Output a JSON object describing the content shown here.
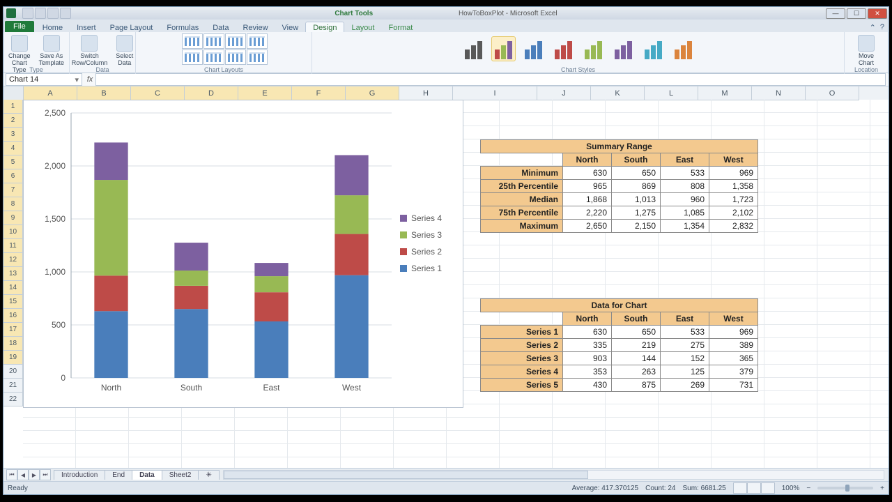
{
  "window": {
    "title_context": "Chart Tools",
    "title_doc": "HowToBoxPlot - Microsoft Excel"
  },
  "tabs": {
    "file": "File",
    "items": [
      "Home",
      "Insert",
      "Page Layout",
      "Formulas",
      "Data",
      "Review",
      "View"
    ],
    "context": [
      "Design",
      "Layout",
      "Format"
    ],
    "active": "Design"
  },
  "ribbon": {
    "type_group": "Type",
    "change_chart_type": "Change\nChart Type",
    "save_as_template": "Save As\nTemplate",
    "data_group": "Data",
    "switch_rowcol": "Switch\nRow/Column",
    "select_data": "Select\nData",
    "layouts_group": "Chart Layouts",
    "styles_group": "Chart Styles",
    "location_group": "Location",
    "move_chart": "Move\nChart"
  },
  "namebox": "Chart 14",
  "columns": [
    "A",
    "B",
    "C",
    "D",
    "E",
    "F",
    "G",
    "H",
    "I",
    "J",
    "K",
    "L",
    "M",
    "N",
    "O"
  ],
  "rows": 22,
  "chart_data": {
    "type": "bar",
    "stacked": true,
    "categories": [
      "North",
      "South",
      "East",
      "West"
    ],
    "series": [
      {
        "name": "Series 1",
        "color": "#4a7ebb",
        "values": [
          630,
          650,
          533,
          969
        ]
      },
      {
        "name": "Series 2",
        "color": "#be4b48",
        "values": [
          335,
          219,
          275,
          389
        ]
      },
      {
        "name": "Series 3",
        "color": "#98b954",
        "values": [
          903,
          144,
          152,
          365
        ]
      },
      {
        "name": "Series 4",
        "color": "#7d60a0",
        "values": [
          353,
          263,
          125,
          379
        ]
      }
    ],
    "ylim": [
      0,
      2500
    ],
    "yticks": [
      0,
      500,
      1000,
      1500,
      2000,
      2500
    ],
    "yticklabels": [
      "0",
      "500",
      "1,000",
      "1,500",
      "2,000",
      "2,500"
    ],
    "legend_order": [
      "Series 4",
      "Series 3",
      "Series 2",
      "Series 1"
    ]
  },
  "summary_table": {
    "title": "Summary Range",
    "cols": [
      "North",
      "South",
      "East",
      "West"
    ],
    "rows": [
      {
        "label": "Minimum",
        "vals": [
          "630",
          "650",
          "533",
          "969"
        ]
      },
      {
        "label": "25th Percentile",
        "vals": [
          "965",
          "869",
          "808",
          "1,358"
        ]
      },
      {
        "label": "Median",
        "vals": [
          "1,868",
          "1,013",
          "960",
          "1,723"
        ]
      },
      {
        "label": "75th Percentile",
        "vals": [
          "2,220",
          "1,275",
          "1,085",
          "2,102"
        ]
      },
      {
        "label": "Maximum",
        "vals": [
          "2,650",
          "2,150",
          "1,354",
          "2,832"
        ]
      }
    ]
  },
  "chart_table": {
    "title": "Data for Chart",
    "cols": [
      "North",
      "South",
      "East",
      "West"
    ],
    "rows": [
      {
        "label": "Series 1",
        "vals": [
          "630",
          "650",
          "533",
          "969"
        ]
      },
      {
        "label": "Series 2",
        "vals": [
          "335",
          "219",
          "275",
          "389"
        ]
      },
      {
        "label": "Series 3",
        "vals": [
          "903",
          "144",
          "152",
          "365"
        ]
      },
      {
        "label": "Series 4",
        "vals": [
          "353",
          "263",
          "125",
          "379"
        ]
      },
      {
        "label": "Series 5",
        "vals": [
          "430",
          "875",
          "269",
          "731"
        ]
      }
    ]
  },
  "sheet_tabs": {
    "items": [
      "Introduction",
      "End",
      "Data",
      "Sheet2"
    ],
    "active": "Data"
  },
  "status": {
    "ready": "Ready",
    "average": "Average: 417.370125",
    "count": "Count: 24",
    "sum": "Sum: 6681.25",
    "zoom": "100%"
  },
  "style_palettes": [
    [
      "#595959",
      "#595959",
      "#595959"
    ],
    [
      "#be4b48",
      "#98b954",
      "#7d60a0"
    ],
    [
      "#4a7ebb",
      "#4a7ebb",
      "#4a7ebb"
    ],
    [
      "#be4b48",
      "#be4b48",
      "#be4b48"
    ],
    [
      "#98b954",
      "#98b954",
      "#98b954"
    ],
    [
      "#7d60a0",
      "#7d60a0",
      "#7d60a0"
    ],
    [
      "#46aac5",
      "#46aac5",
      "#46aac5"
    ],
    [
      "#db843d",
      "#db843d",
      "#db843d"
    ]
  ]
}
